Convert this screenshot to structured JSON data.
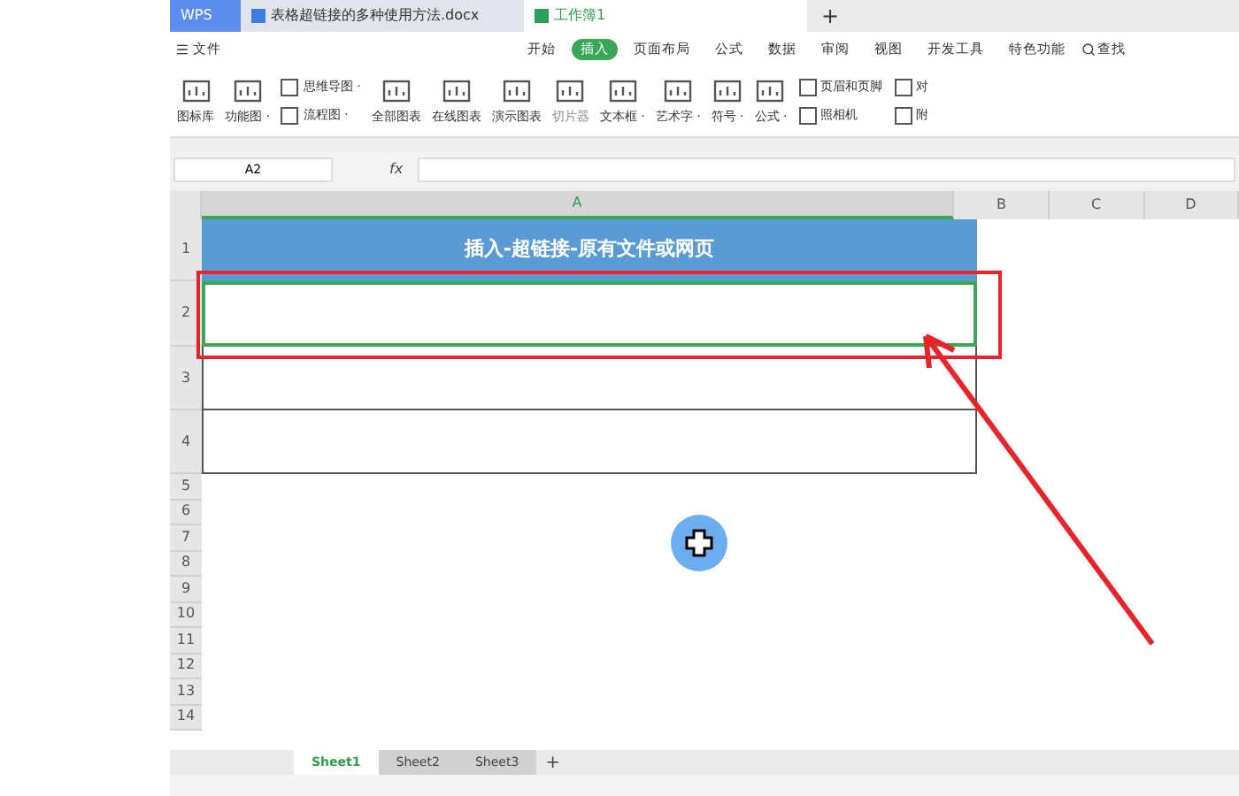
{
  "app_button": "WPS",
  "tabs": [
    {
      "label": "表格超链接的多种使用方法.docx",
      "kind": "doc",
      "selected": false
    },
    {
      "label": "工作簿1",
      "kind": "sheet",
      "selected": true
    }
  ],
  "new_tab": "+",
  "menu": {
    "file": "文件",
    "items": [
      {
        "label": "开始",
        "selected": false
      },
      {
        "label": "插入",
        "selected": true
      },
      {
        "label": "页面布局",
        "selected": false
      },
      {
        "label": "公式",
        "selected": false
      },
      {
        "label": "数据",
        "selected": false
      },
      {
        "label": "审阅",
        "selected": false
      },
      {
        "label": "视图",
        "selected": false
      },
      {
        "label": "开发工具",
        "selected": false
      },
      {
        "label": "特色功能",
        "selected": false
      }
    ],
    "search": "查找"
  },
  "ribbon": [
    {
      "kind": "large",
      "label": "图标库",
      "disabled": false
    },
    {
      "kind": "large",
      "label": "功能图 ·",
      "disabled": false
    },
    {
      "kind": "pair",
      "items": [
        "思维导图 ·",
        "流程图 ·"
      ]
    },
    {
      "kind": "large",
      "label": "全部图表",
      "disabled": false
    },
    {
      "kind": "large",
      "label": "在线图表",
      "disabled": false
    },
    {
      "kind": "large",
      "label": "演示图表",
      "disabled": false
    },
    {
      "kind": "large",
      "label": "切片器",
      "disabled": true
    },
    {
      "kind": "large",
      "label": "文本框 ·",
      "disabled": false
    },
    {
      "kind": "large",
      "label": "艺术字 ·",
      "disabled": false
    },
    {
      "kind": "large",
      "label": "符号 ·",
      "disabled": false
    },
    {
      "kind": "large",
      "label": "公式 ·",
      "disabled": false
    },
    {
      "kind": "pair",
      "items": [
        "页眉和页脚",
        "照相机"
      ]
    },
    {
      "kind": "pair",
      "items": [
        "对",
        "附"
      ]
    }
  ],
  "formula_bar": {
    "cell": "A2",
    "fx": "fx"
  },
  "columns": [
    {
      "label": "A",
      "selected": true
    },
    {
      "label": "B",
      "selected": false
    },
    {
      "label": "C",
      "selected": false
    },
    {
      "label": "D",
      "selected": false
    }
  ],
  "rows": [
    {
      "label": "1",
      "cell": "插入-超链接-原有文件或网页",
      "kind": "header"
    },
    {
      "label": "2",
      "kind": "selected"
    },
    {
      "label": "3",
      "kind": "table"
    },
    {
      "label": "4",
      "kind": "table"
    },
    {
      "label": "5",
      "kind": "plain"
    },
    {
      "label": "6",
      "kind": "plain"
    },
    {
      "label": "7",
      "kind": "plain"
    },
    {
      "label": "8",
      "kind": "plain"
    },
    {
      "label": "9",
      "kind": "plain"
    },
    {
      "label": "10",
      "kind": "plain"
    },
    {
      "label": "11",
      "kind": "plain"
    },
    {
      "label": "12",
      "kind": "plain"
    },
    {
      "label": "13",
      "kind": "plain"
    },
    {
      "label": "14",
      "kind": "plain"
    }
  ],
  "sheets": [
    {
      "label": "Sheet1",
      "selected": true
    },
    {
      "label": "Sheet2",
      "selected": false
    },
    {
      "label": "Sheet3",
      "selected": false
    }
  ],
  "add_sheet": "+"
}
